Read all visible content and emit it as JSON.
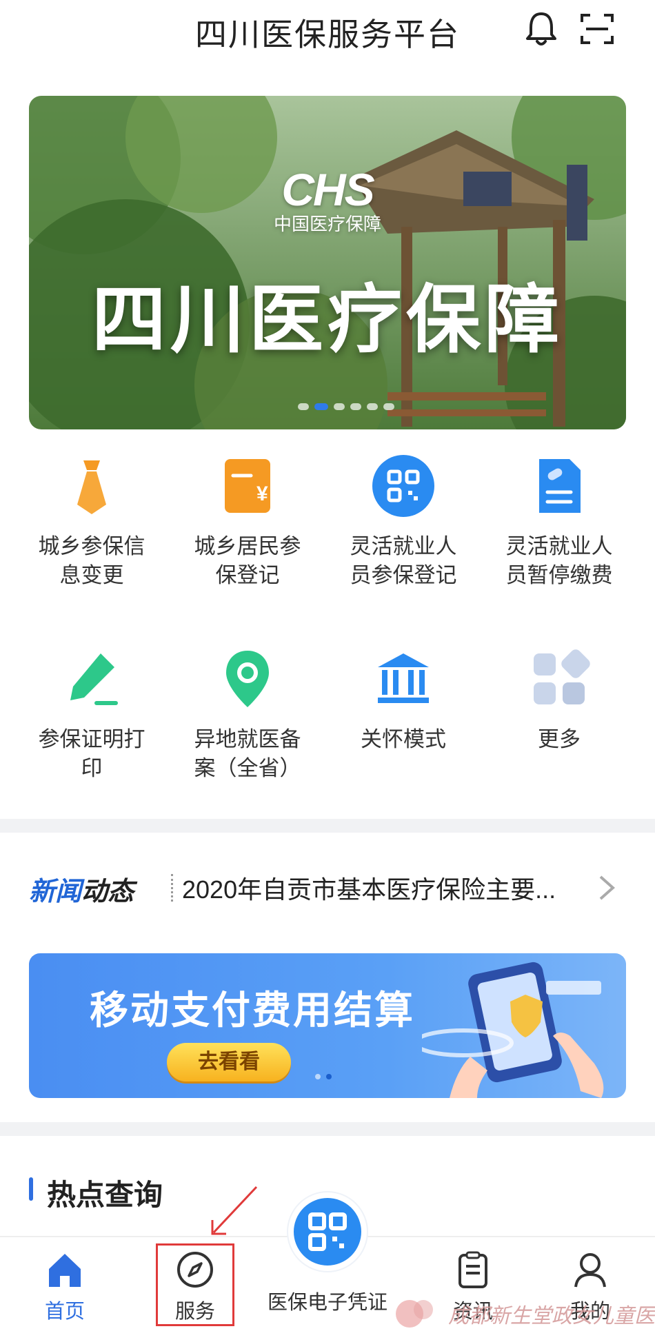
{
  "header": {
    "title": "四川医保服务平台",
    "icons": [
      "bell-icon",
      "scan-icon"
    ]
  },
  "banner": {
    "logo_text": "CHS",
    "logo_sub": "中国医疗保障",
    "title": "四川医疗保障",
    "slide_count": 6,
    "active_slide": 2
  },
  "grid": {
    "items": [
      {
        "label_line1": "城乡参保信",
        "label_line2": "息变更",
        "icon": "tie-icon"
      },
      {
        "label_line1": "城乡居民参",
        "label_line2": "保登记",
        "icon": "yuan-card-icon"
      },
      {
        "label_line1": "灵活就业人",
        "label_line2": "员参保登记",
        "icon": "qr-code-icon"
      },
      {
        "label_line1": "灵活就业人",
        "label_line2": "员暂停缴费",
        "icon": "document-icon"
      },
      {
        "label_line1": "参保证明打",
        "label_line2": "印",
        "icon": "pen-icon"
      },
      {
        "label_line1": "异地就医备",
        "label_line2": "案（全省）",
        "icon": "location-pin-icon"
      },
      {
        "label_line1": "关怀模式",
        "label_line2": "",
        "icon": "bank-icon"
      },
      {
        "label_line1": "更多",
        "label_line2": "",
        "icon": "more-apps-icon"
      }
    ]
  },
  "news": {
    "logo_part1": "新闻",
    "logo_part2": "动态",
    "headline": "2020年自贡市基本医疗保险主要..."
  },
  "promo": {
    "title": "移动支付费用结算",
    "button": "去看看",
    "slide_count": 2,
    "active_slide": 2
  },
  "hot": {
    "title": "热点查询"
  },
  "tabbar": {
    "tabs": [
      {
        "label": "首页",
        "icon": "home-icon",
        "active": true
      },
      {
        "label": "服务",
        "icon": "compass-icon",
        "active": false
      },
      {
        "label": "医保电子凭证",
        "icon": "qr-code-icon",
        "active": false
      },
      {
        "label": "资讯",
        "icon": "clipboard-icon",
        "active": false
      },
      {
        "label": "我的",
        "icon": "user-icon",
        "active": false
      }
    ]
  },
  "watermark": {
    "text": "成都新生堂政女儿童医院"
  },
  "colors": {
    "primary": "#2f6fe0",
    "orange": "#f59a23",
    "green": "#2dc88a",
    "annotation": "#e03a3a"
  }
}
